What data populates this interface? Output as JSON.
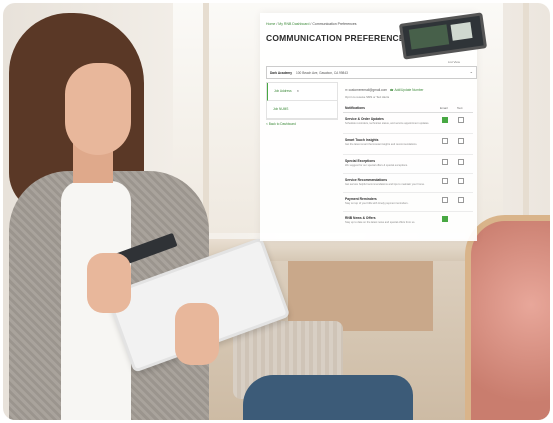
{
  "breadcrumb": {
    "home": "Home",
    "sep1": "/",
    "dashboard": "My RNB Dashboard",
    "sep2": "/",
    "current": "Communication Preferences"
  },
  "page_title": "COMMUNICATION PREFERENCES",
  "view_toggle": "List View",
  "address": {
    "label": "Dark Academy",
    "value": "100 Beach Ave, Gasabon, CA 99843"
  },
  "side_nav": [
    {
      "label": "Job Address",
      "badge": "8"
    },
    {
      "label": "Job NUMS",
      "badge": ""
    }
  ],
  "back_link": "< Back to Dashboard",
  "contact": {
    "email": "customeremail@gmail.com",
    "action": "Add/Update Number",
    "sub": "Opt in to receive SMS or Text Alerts"
  },
  "table": {
    "headers": {
      "notifications": "Notifications",
      "email": "Email",
      "text": "Text"
    },
    "rows": [
      {
        "title": "Service & Order Updates",
        "desc": "Schedule reminders, technician status, and service appointment updates.",
        "email": true,
        "text": false
      },
      {
        "title": "Smart Touch Insights",
        "desc": "Get the latest smart thermostat insights and recommendations.",
        "email": false,
        "text": false
      },
      {
        "title": "Special Exceptions",
        "desc": "We suggest for our special offers & special exceptions.",
        "email": false,
        "text": false
      },
      {
        "title": "Service Recommendations",
        "desc": "Get service helpful recommendations and tips to maintain your home.",
        "email": false,
        "text": false
      },
      {
        "title": "Payment Reminders",
        "desc": "Stay on top of your bills with timely payment reminders.",
        "email": false,
        "text": false
      },
      {
        "title": "RNB News & Offers",
        "desc": "Stay up to date on the latest news and special offers from us.",
        "email": true,
        "text": false
      }
    ]
  },
  "colors": {
    "accent": "#48a843",
    "link": "#3d8a3a",
    "title": "#2b2b2b"
  }
}
